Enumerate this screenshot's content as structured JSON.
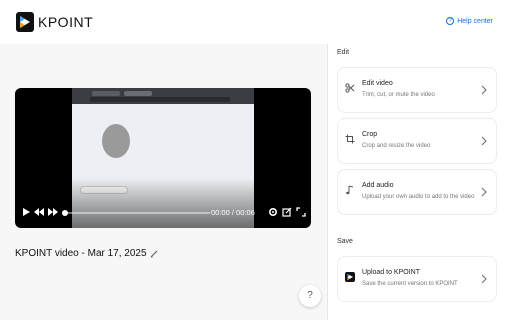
{
  "header": {
    "brand": "KPOINT",
    "help_label": "Help center"
  },
  "player": {
    "time": "00:00 / 00:06",
    "progress_fraction": 0.0
  },
  "video": {
    "title": "KPOINT video - Mar 17, 2025"
  },
  "fab": {
    "label": "?"
  },
  "edit_section": {
    "label": "Edit",
    "cards": [
      {
        "title": "Edit video",
        "subtitle": "Trim, cut, or mute the video",
        "icon": "scissors-icon"
      },
      {
        "title": "Crop",
        "subtitle": "Crop and resize the video",
        "icon": "crop-icon"
      },
      {
        "title": "Add audio",
        "subtitle": "Upload your own audio to add to the video",
        "icon": "music-note-icon"
      }
    ]
  },
  "save_section": {
    "label": "Save",
    "cards": [
      {
        "title": "Upload to KPOINT",
        "subtitle": "Save the current version to KPOINT",
        "icon": "kpoint-logo-icon"
      }
    ]
  },
  "colors": {
    "accent": "#1a6ee0",
    "player_bg": "#000000",
    "panel_bg": "#f7f7f7"
  }
}
